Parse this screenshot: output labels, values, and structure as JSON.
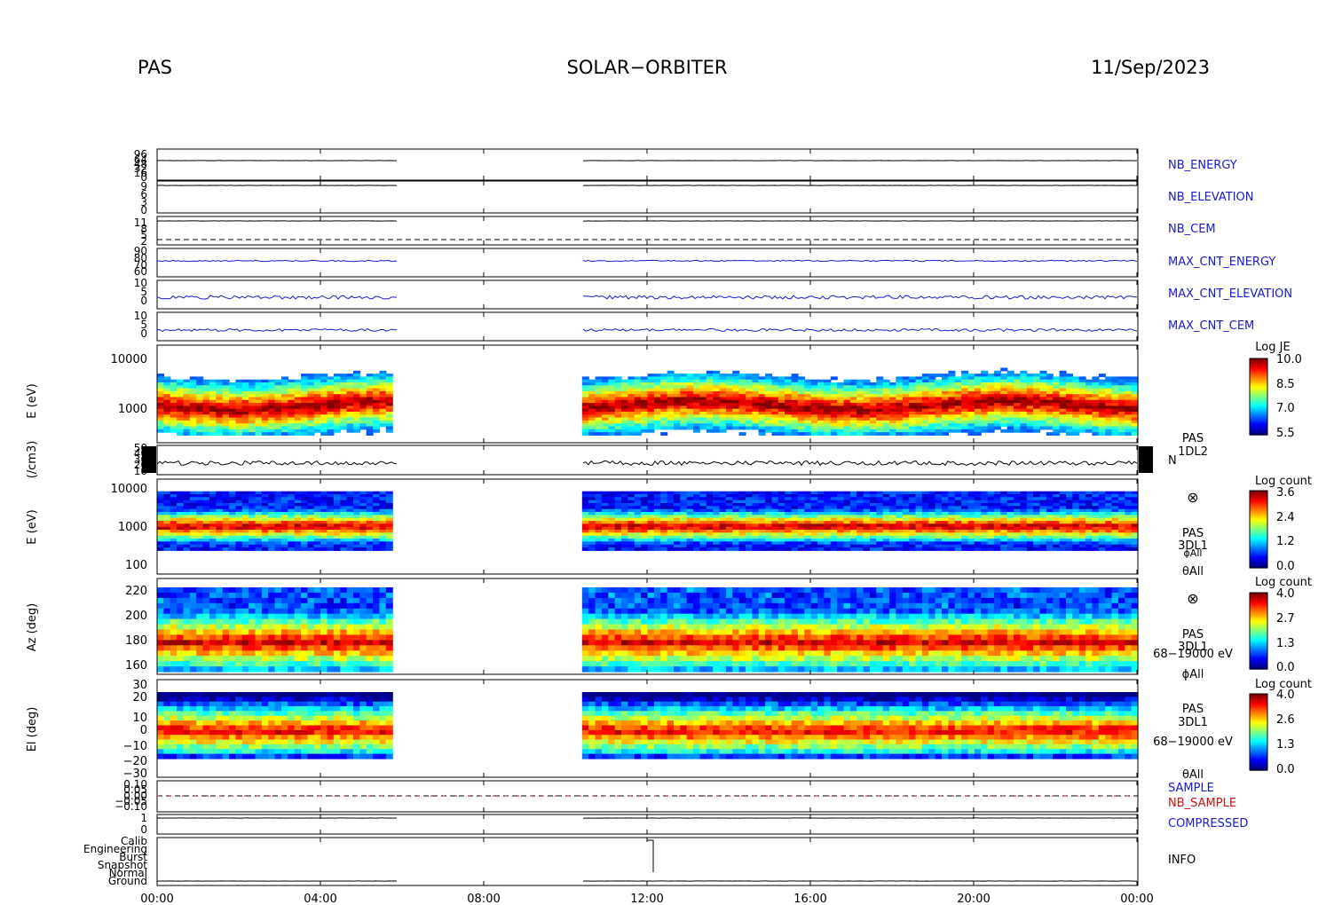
{
  "header": {
    "instrument": "PAS",
    "mission": "SOLAR−ORBITER",
    "date": "11/Sep/2023"
  },
  "x_axis": {
    "ticks": [
      "00:00",
      "04:00",
      "08:00",
      "12:00",
      "16:00",
      "20:00",
      "00:00"
    ]
  },
  "hk_panels": [
    {
      "label": "NB_ENERGY",
      "ticks": [
        "96",
        "64",
        "48",
        "32",
        "16",
        "0"
      ]
    },
    {
      "label": "NB_ELEVATION",
      "ticks": [
        "9",
        "6",
        "3",
        "0"
      ]
    },
    {
      "label": "NB_CEM",
      "ticks": [
        "11",
        "8",
        "5",
        "2"
      ]
    },
    {
      "label": "MAX_CNT_ENERGY",
      "ticks": [
        "90",
        "80",
        "70",
        "60"
      ]
    },
    {
      "label": "MAX_CNT_ELEVATION",
      "ticks": [
        "10",
        "5",
        "0"
      ]
    },
    {
      "label": "MAX_CNT_CEM",
      "ticks": [
        "10",
        "5",
        "0"
      ]
    }
  ],
  "spec1": {
    "ylabel": "E (eV)",
    "ticks": [
      "10000",
      "1000"
    ],
    "tag1": "PAS",
    "tag2": "1DL2",
    "cb_title": "Log JE",
    "cb_ticks": [
      "10.0",
      "8.5",
      "7.0",
      "5.5"
    ]
  },
  "density": {
    "ylabel": "(/cm3)",
    "ticks": [
      "50",
      "40",
      "30",
      "20",
      "10"
    ],
    "tag": "N"
  },
  "spec2": {
    "ylabel": "E (eV)",
    "ticks": [
      "10000",
      "1000",
      "100"
    ],
    "symbol": "⊗",
    "tag1": "PAS",
    "tag2": "3DL1",
    "tag3": "ϕAll",
    "tag4": "θAll",
    "cb_title": "Log count",
    "cb_ticks": [
      "3.6",
      "2.4",
      "1.2",
      "0.0"
    ]
  },
  "spec3": {
    "ylabel": "Az (deg)",
    "ticks": [
      "220",
      "200",
      "180",
      "160"
    ],
    "symbol": "⊗",
    "tag1": "PAS",
    "tag2": "3DL1",
    "tag3": "68−19000 eV",
    "tag4": "ϕAll",
    "cb_title": "Log count",
    "cb_ticks": [
      "4.0",
      "2.7",
      "1.3",
      "0.0"
    ]
  },
  "spec4": {
    "ylabel": "El (deg)",
    "ticks": [
      "30",
      "20",
      "10",
      "0",
      "−10",
      "−20",
      "−30"
    ],
    "tag1": "PAS",
    "tag2": "3DL1",
    "tag3": "68−19000 eV",
    "tag4": "θAll",
    "cb_title": "Log count",
    "cb_ticks": [
      "4.0",
      "2.6",
      "1.3",
      "0.0"
    ]
  },
  "sample": {
    "ticks": [
      "0.10",
      "0.05",
      "0.00",
      "−0.05",
      "−0.10"
    ],
    "label1": "SAMPLE",
    "label2": "NB_SAMPLE"
  },
  "compressed": {
    "ticks": [
      "1",
      "0"
    ],
    "label": "COMPRESSED"
  },
  "info": {
    "ticks": [
      "Calib",
      "Engineering",
      "Burst",
      "Snapshot",
      "Normal",
      "Ground"
    ],
    "label": "INFO"
  },
  "colors": {
    "blue_trace": "#1a1acd",
    "red_label": "#d41010"
  },
  "chart_data": {
    "type": "heatmap",
    "x_range": [
      "00:00",
      "24:00"
    ],
    "data_gaps": [
      [
        "05:50",
        "10:20"
      ]
    ],
    "panels": [
      {
        "name": "PAS 1DL2 energy spectrogram",
        "ylabel": "E (eV)",
        "yscale": "log",
        "ylim": [
          300,
          12000
        ],
        "colorbar": "Log JE",
        "crange": [
          5.5,
          10.0
        ]
      },
      {
        "name": "N",
        "ylabel": "(/cm3)",
        "ylim": [
          10,
          50
        ]
      },
      {
        "name": "PAS 3DL1 energy spectrogram",
        "ylabel": "E (eV)",
        "yscale": "log",
        "ylim": [
          80,
          12000
        ],
        "colorbar": "Log count",
        "crange": [
          0.0,
          3.6
        ]
      },
      {
        "name": "PAS 3DL1 azimuth",
        "ylabel": "Az (deg)",
        "ylim": [
          150,
          225
        ],
        "colorbar": "Log count",
        "crange": [
          0.0,
          4.0
        ]
      },
      {
        "name": "PAS 3DL1 elevation",
        "ylabel": "El (deg)",
        "ylim": [
          -30,
          30
        ],
        "colorbar": "Log count",
        "crange": [
          0.0,
          4.0
        ]
      }
    ]
  }
}
